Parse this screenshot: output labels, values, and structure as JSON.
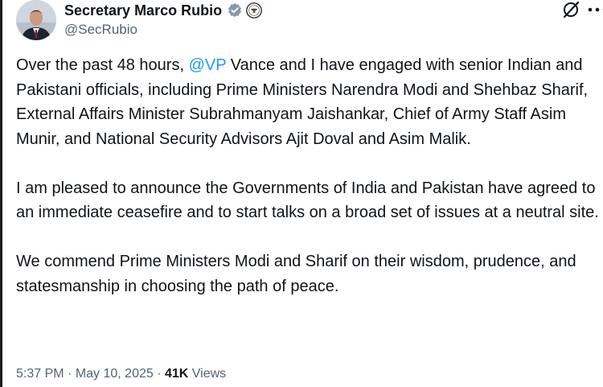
{
  "author": {
    "name": "Secretary Marco Rubio",
    "handle": "@SecRubio"
  },
  "tweet": {
    "para1": {
      "before": "Over the past 48 hours, ",
      "mention": "@VP",
      "after": " Vance and I have engaged with senior Indian and Pakistani officials, including Prime Ministers Narendra Modi and Shehbaz Sharif, External Affairs Minister Subrahmanyam Jaishankar, Chief of Army Staff Asim Munir, and National Security Advisors Ajit Doval and Asim Malik."
    },
    "para2": "I am pleased to announce the Governments of India and Pakistan have agreed to an immediate ceasefire and to start talks on a broad set of issues at a neutral site.",
    "para3": "We commend Prime Ministers Modi and Sharif on their wisdom, prudence, and statesmanship in choosing the path of peace."
  },
  "meta": {
    "time": "5:37 PM",
    "sep1": " · ",
    "date": "May 10, 2025",
    "sep2": " · ",
    "views_count": "41K",
    "views_label": " Views"
  },
  "colors": {
    "mention": "#1d9bf0",
    "verified": "#829aab",
    "secondary_text": "#536471"
  },
  "icons": {
    "verified": "verified-badge-icon",
    "seal": "state-department-seal-icon",
    "grok": "grok-icon",
    "more": "more-icon"
  }
}
